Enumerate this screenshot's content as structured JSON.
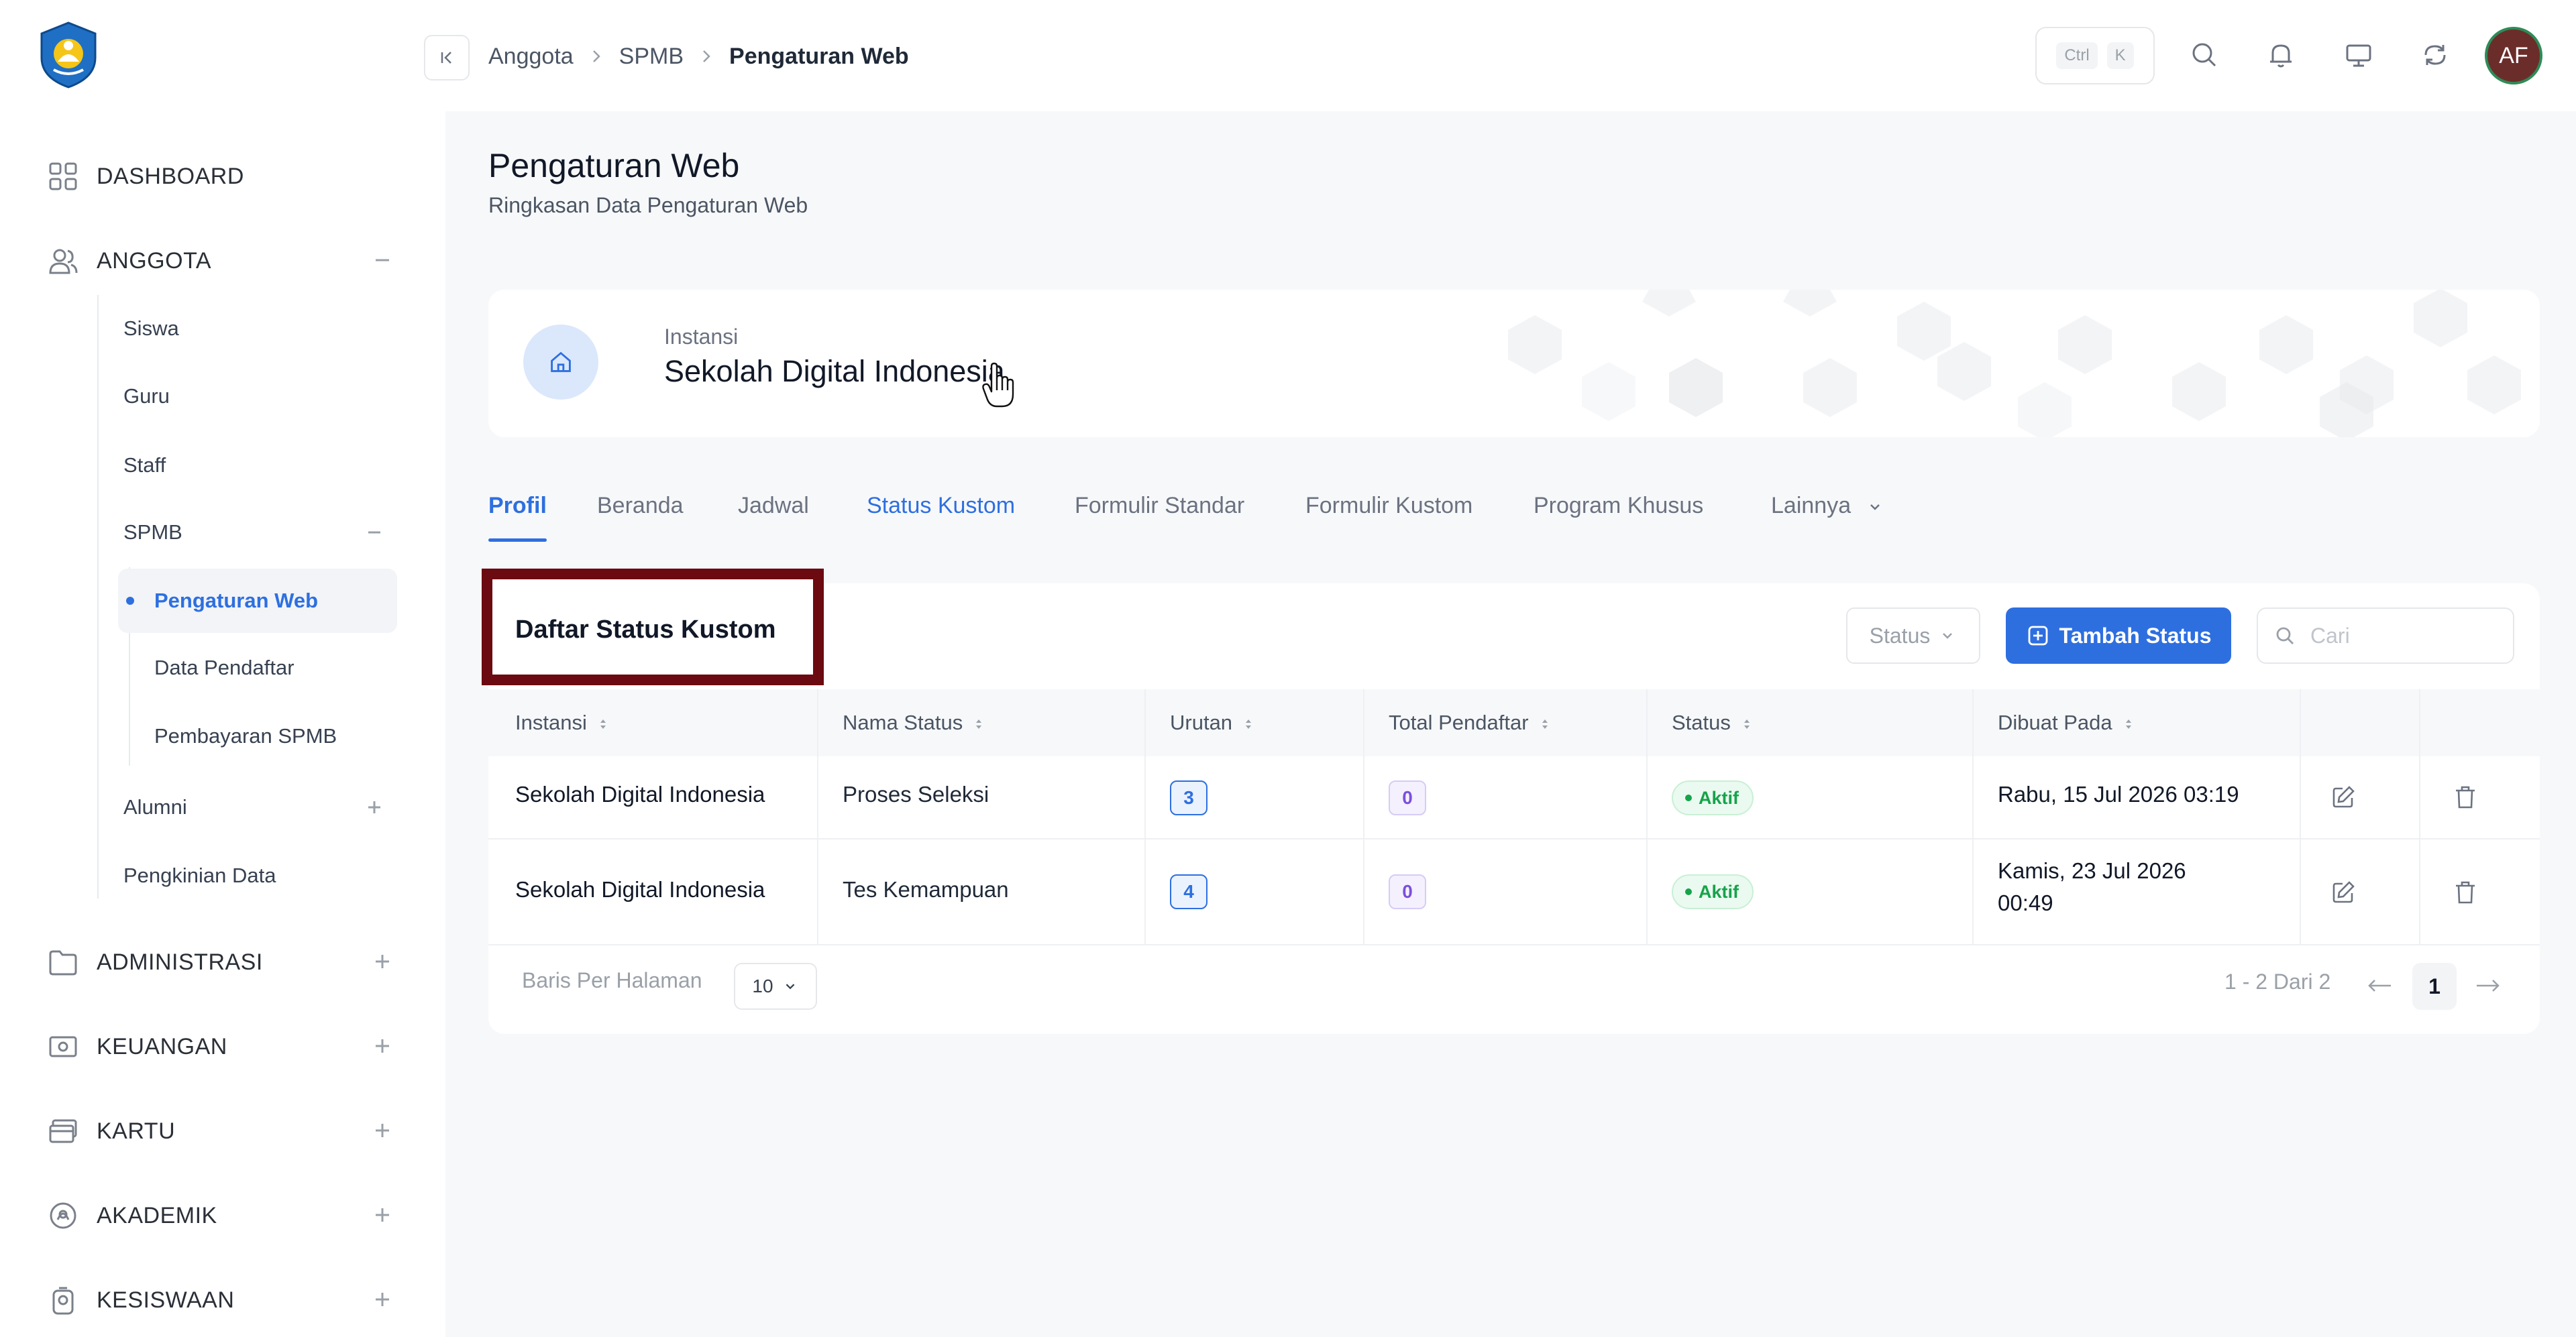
{
  "sidebar": {
    "dashboard": "DASHBOARD",
    "anggota": "ANGGOTA",
    "anggota_items": [
      "Siswa",
      "Guru",
      "Staff"
    ],
    "spmb": "SPMB",
    "spmb_items": [
      "Pengaturan Web",
      "Data Pendaftar",
      "Pembayaran SPMB"
    ],
    "anggota_items2": [
      "Alumni",
      "Pengkinian Data"
    ],
    "administrasi": "ADMINISTRASI",
    "keuangan": "KEUANGAN",
    "kartu": "KARTU",
    "akademik": "AKADEMIK",
    "kesiswaan": "KESISWAAN"
  },
  "topbar": {
    "breadcrumb": [
      "Anggota",
      "SPMB",
      "Pengaturan Web"
    ],
    "kbd": [
      "Ctrl",
      "K"
    ],
    "avatar": "AF"
  },
  "page": {
    "title": "Pengaturan Web",
    "subtitle": "Ringkasan Data Pengaturan Web"
  },
  "instansi": {
    "label": "Instansi",
    "name": "Sekolah Digital Indonesia"
  },
  "tabs": [
    "Profil",
    "Beranda",
    "Jadwal",
    "Status Kustom",
    "Formulir Standar",
    "Formulir Kustom",
    "Program Khusus",
    "Lainnya"
  ],
  "table": {
    "title": "Daftar Status Kustom",
    "status_filter": "Status",
    "add_button": "Tambah Status",
    "search_placeholder": "Cari",
    "columns": [
      "Instansi",
      "Nama Status",
      "Urutan",
      "Total Pendaftar",
      "Status",
      "Dibuat Pada"
    ],
    "rows": [
      {
        "instansi": "Sekolah Digital Indonesia",
        "nama": "Proses Seleksi",
        "urutan": "3",
        "total": "0",
        "status": "Aktif",
        "dibuat1": "Rabu, 15 Jul 2026 03:19",
        "dibuat2": ""
      },
      {
        "instansi": "Sekolah Digital Indonesia",
        "nama": "Tes Kemampuan",
        "urutan": "4",
        "total": "0",
        "status": "Aktif",
        "dibuat1": "Kamis, 23 Jul 2026",
        "dibuat2": "00:49"
      }
    ]
  },
  "pagination": {
    "per_page_label": "Baris Per Halaman",
    "per_page": "10",
    "range": "1 - 2 Dari 2",
    "current": "1"
  },
  "colors": {
    "accent": "#2e6fe0",
    "highlight_border": "#6b0a10",
    "success": "#16a34a"
  }
}
